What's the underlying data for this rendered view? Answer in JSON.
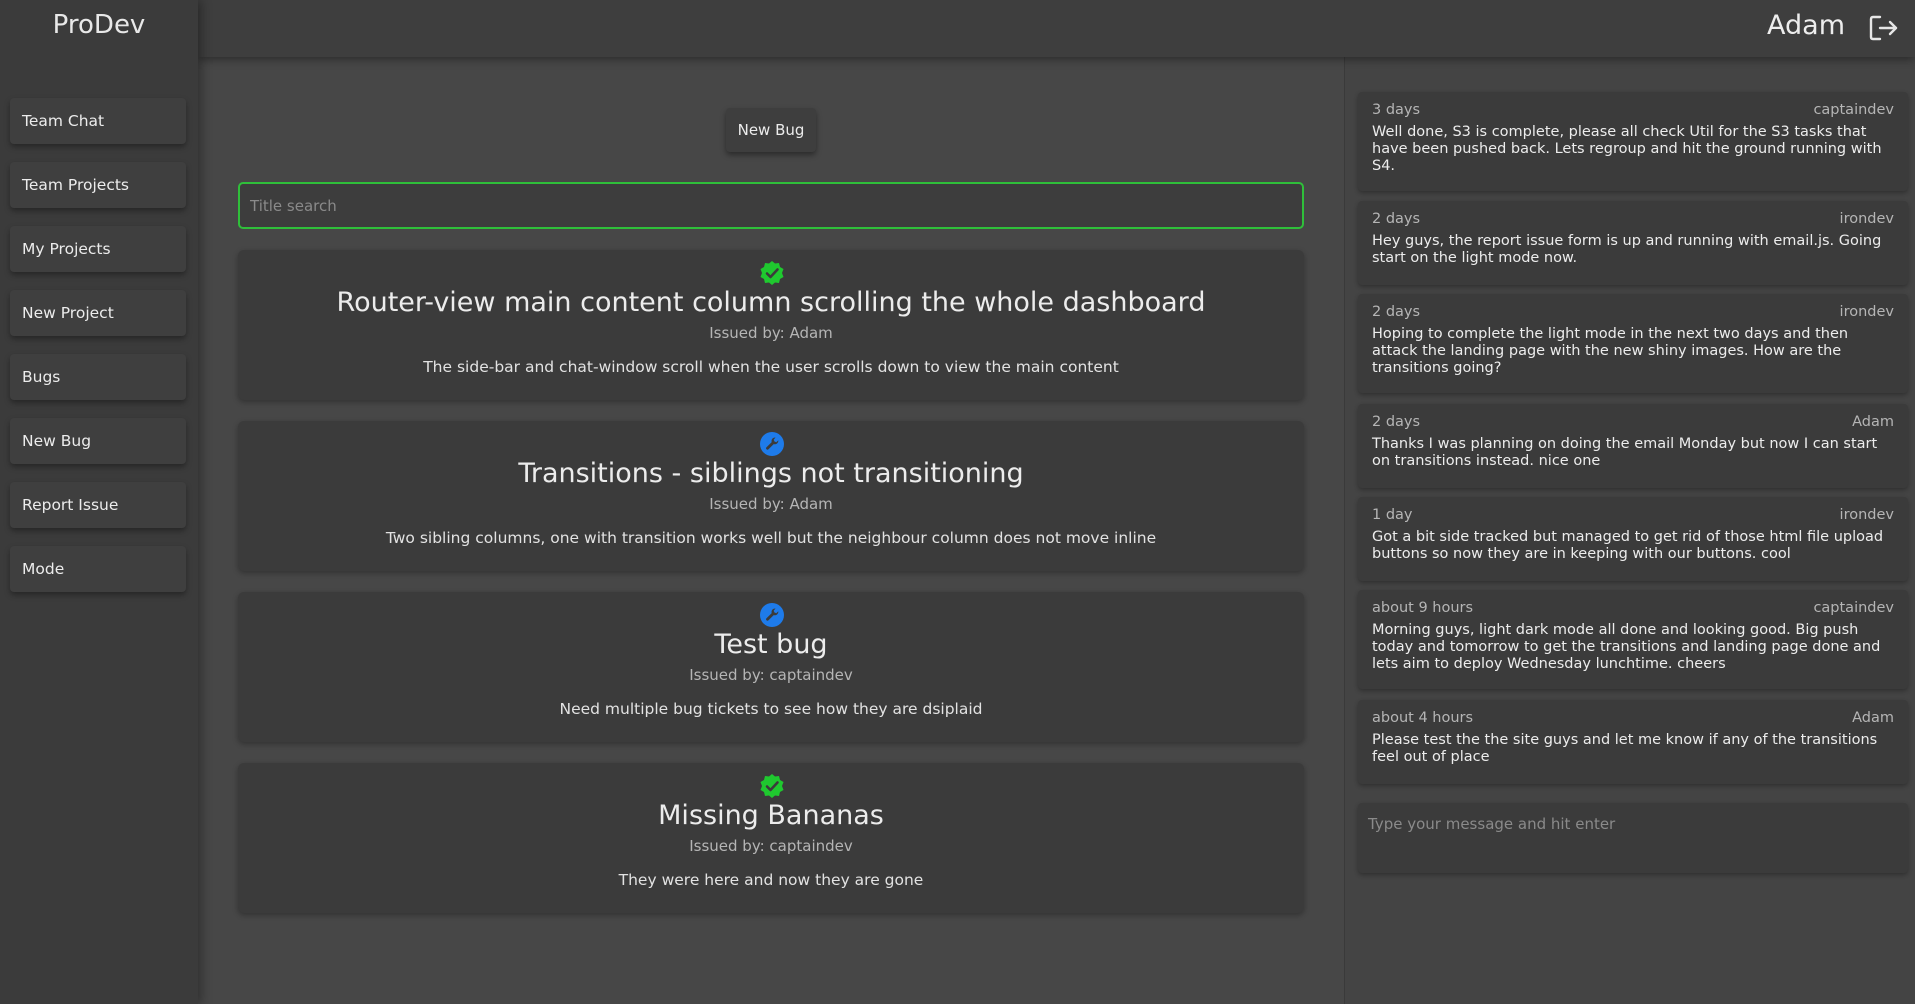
{
  "app": {
    "brand": "ProDev"
  },
  "sidebar": {
    "items": [
      {
        "label": "Team Chat"
      },
      {
        "label": "Team Projects"
      },
      {
        "label": "My Projects"
      },
      {
        "label": "New Project"
      },
      {
        "label": "Bugs"
      },
      {
        "label": "New Bug"
      },
      {
        "label": "Report Issue"
      },
      {
        "label": "Mode"
      }
    ]
  },
  "header": {
    "user": "Adam",
    "logout_icon": "logout-icon"
  },
  "main": {
    "new_bug_label": "New Bug",
    "search_placeholder": "Title search",
    "bugs": [
      {
        "status": "resolved",
        "icon": "check-badge-icon",
        "title": "Router-view main content column scrolling the whole dashboard",
        "issued": "Issued by: Adam",
        "description": "The side-bar and chat-window scroll when the user scrolls down to view the main content"
      },
      {
        "status": "in-progress",
        "icon": "wrench-icon",
        "title": "Transitions - siblings not transitioning",
        "issued": "Issued by: Adam",
        "description": "Two sibling columns, one with transition works well but the neighbour column does not move inline"
      },
      {
        "status": "in-progress",
        "icon": "wrench-icon",
        "title": "Test bug",
        "issued": "Issued by: captaindev",
        "description": "Need multiple bug tickets to see how they are dsiplaid"
      },
      {
        "status": "resolved",
        "icon": "check-badge-icon",
        "title": "Missing Bananas",
        "issued": "Issued by: captaindev",
        "description": "They were here and now they are gone"
      }
    ]
  },
  "chat": {
    "messages": [
      {
        "time": "3 days",
        "author": "captaindev",
        "text": "Well done, S3 is complete, please all check Util for the S3 tasks that have been pushed back. Lets regroup and hit the ground running with S4."
      },
      {
        "time": "2 days",
        "author": "irondev",
        "text": "Hey guys, the report issue form is up and running with email.js. Going start on the light mode now."
      },
      {
        "time": "2 days",
        "author": "irondev",
        "text": "Hoping to complete the light mode in the next two days and then attack the landing page with the new shiny images. How are the transitions going?"
      },
      {
        "time": "2 days",
        "author": "Adam",
        "text": "Thanks I was planning on doing the email Monday but now I can start on transitions instead. nice one"
      },
      {
        "time": "1 day",
        "author": "irondev",
        "text": "Got a bit side tracked but managed to get rid of those html file upload buttons so now they are in keeping with our buttons. cool"
      },
      {
        "time": "about 9 hours",
        "author": "captaindev",
        "text": "Morning guys, light dark mode all done and looking good. Big push today and tomorrow to get the transitions and landing page done and lets aim to deploy Wednesday lunchtime. cheers"
      },
      {
        "time": "about 4 hours",
        "author": "Adam",
        "text": "Please test the the site guys and let me know if any of the transitions feel out of place"
      }
    ],
    "input_placeholder": "Type your message and hit enter"
  },
  "colors": {
    "accent_green": "#2fbf3a",
    "resolved": "#1fc92f",
    "in_progress": "#1e7bea"
  }
}
